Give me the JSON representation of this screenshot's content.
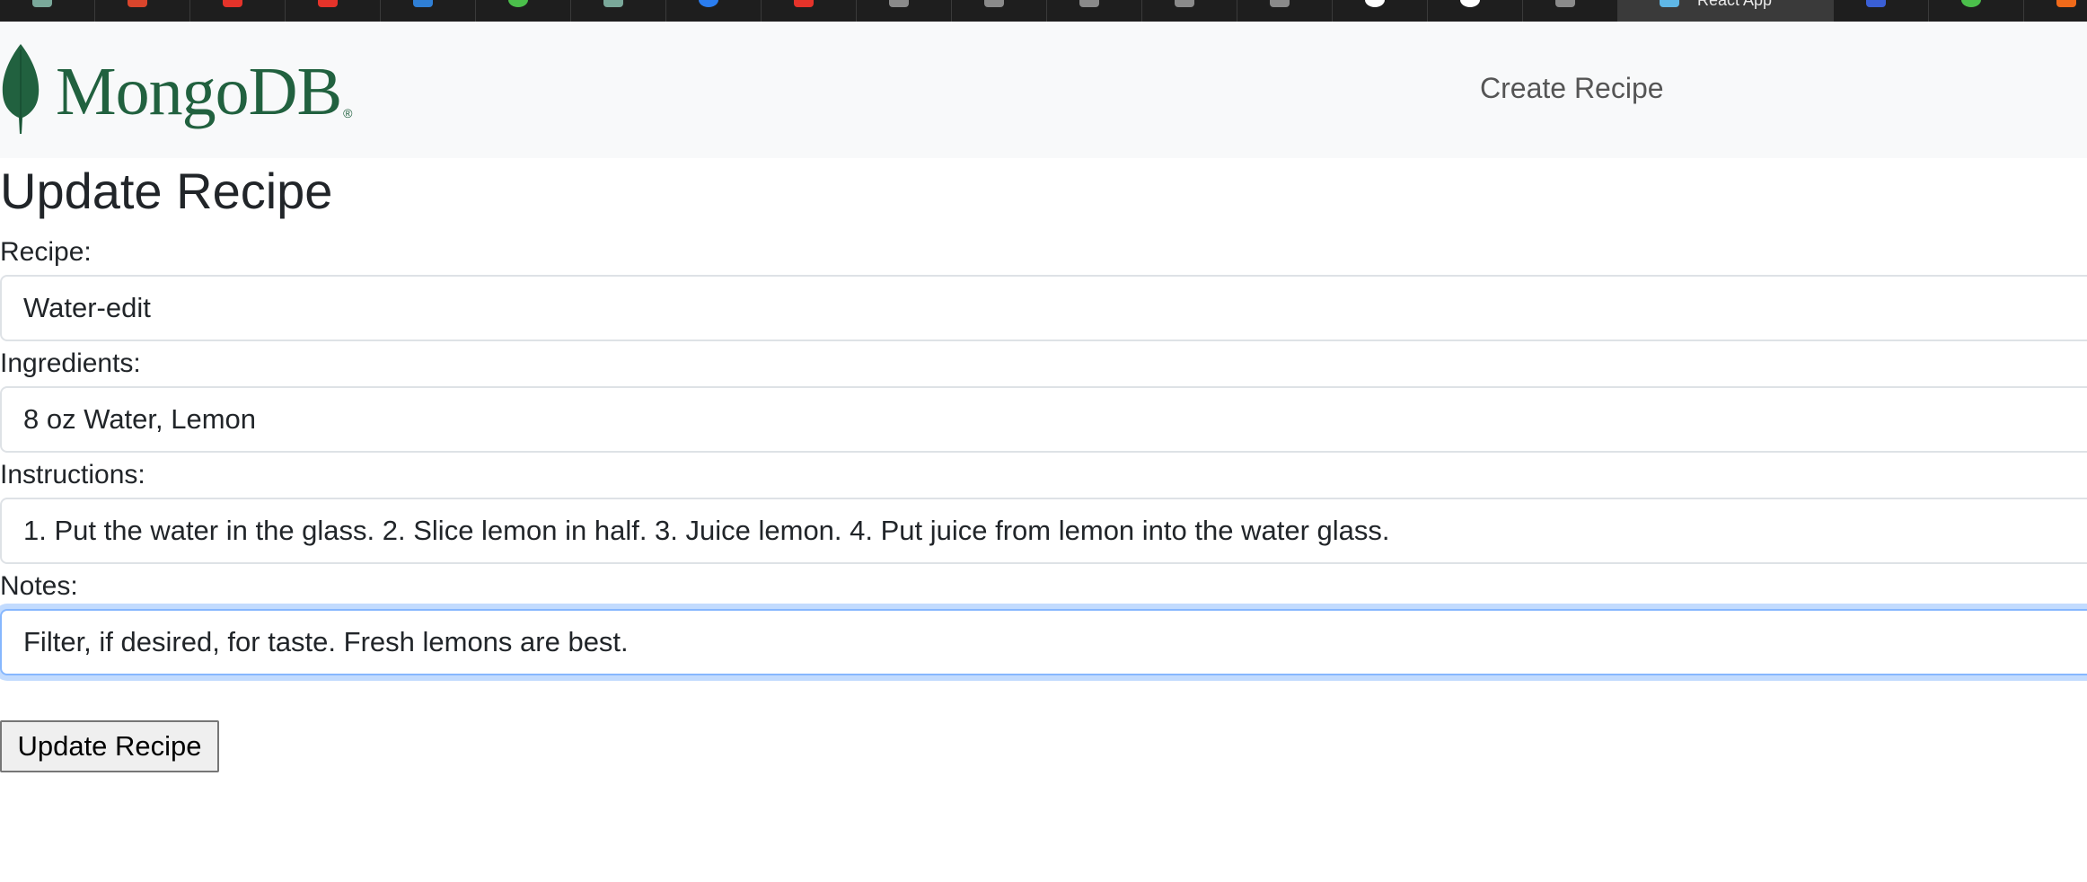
{
  "tabstrip": {
    "active_tab_label": "React App",
    "tabs": [
      {
        "icon": "openai-icon",
        "color": "#7aa89a"
      },
      {
        "icon": "link-icon",
        "color": "#d9452c"
      },
      {
        "icon": "red-app-icon",
        "color": "#e5332a"
      },
      {
        "icon": "red-app-icon",
        "color": "#e5332a"
      },
      {
        "icon": "blue-app-icon",
        "color": "#2f7fd5"
      },
      {
        "icon": "green-circle-icon",
        "color": "#4bbf4b"
      },
      {
        "icon": "openai-icon",
        "color": "#7aa89a"
      },
      {
        "icon": "browser-icon",
        "color": "#2a7df0"
      },
      {
        "icon": "red-app-icon",
        "color": "#e5332a"
      },
      {
        "icon": "grey-app-icon",
        "color": "#8a8a8a"
      },
      {
        "icon": "grey-app-icon",
        "color": "#8a8a8a"
      },
      {
        "icon": "grey-app-icon",
        "color": "#8a8a8a"
      },
      {
        "icon": "grey-app-icon",
        "color": "#8a8a8a"
      },
      {
        "icon": "grey-app-icon",
        "color": "#8a8a8a"
      },
      {
        "icon": "github-icon",
        "color": "#ffffff"
      },
      {
        "icon": "github-icon",
        "color": "#ffffff"
      },
      {
        "icon": "grey-app-icon",
        "color": "#8a8a8a"
      },
      {
        "icon": "react-icon",
        "color": "#5fb7e6"
      },
      {
        "icon": "blue-app-icon",
        "color": "#3a5fd5"
      },
      {
        "icon": "green-circle-icon",
        "color": "#4bbf4b"
      },
      {
        "icon": "orange-app-icon",
        "color": "#f06a1a"
      }
    ]
  },
  "navbar": {
    "brand": "MongoDB",
    "brand_mark": "®",
    "brand_color": "#21613f",
    "create_link": "Create Recipe"
  },
  "form": {
    "title": "Update Recipe",
    "recipe_label": "Recipe:",
    "recipe_value": "Water-edit",
    "ingredients_label": "Ingredients:",
    "ingredients_value": "8 oz Water, Lemon",
    "instructions_label": "Instructions:",
    "instructions_value": "1. Put the water in the glass. 2. Slice lemon in half. 3. Juice lemon. 4. Put juice from lemon into the water glass.",
    "notes_label": "Notes:",
    "notes_value": "Filter, if desired, for taste. Fresh lemons are best.",
    "submit_label": "Update Recipe"
  },
  "colors": {
    "focus_ring": "#86b7fe",
    "navbar_bg": "#f8f9fa"
  }
}
